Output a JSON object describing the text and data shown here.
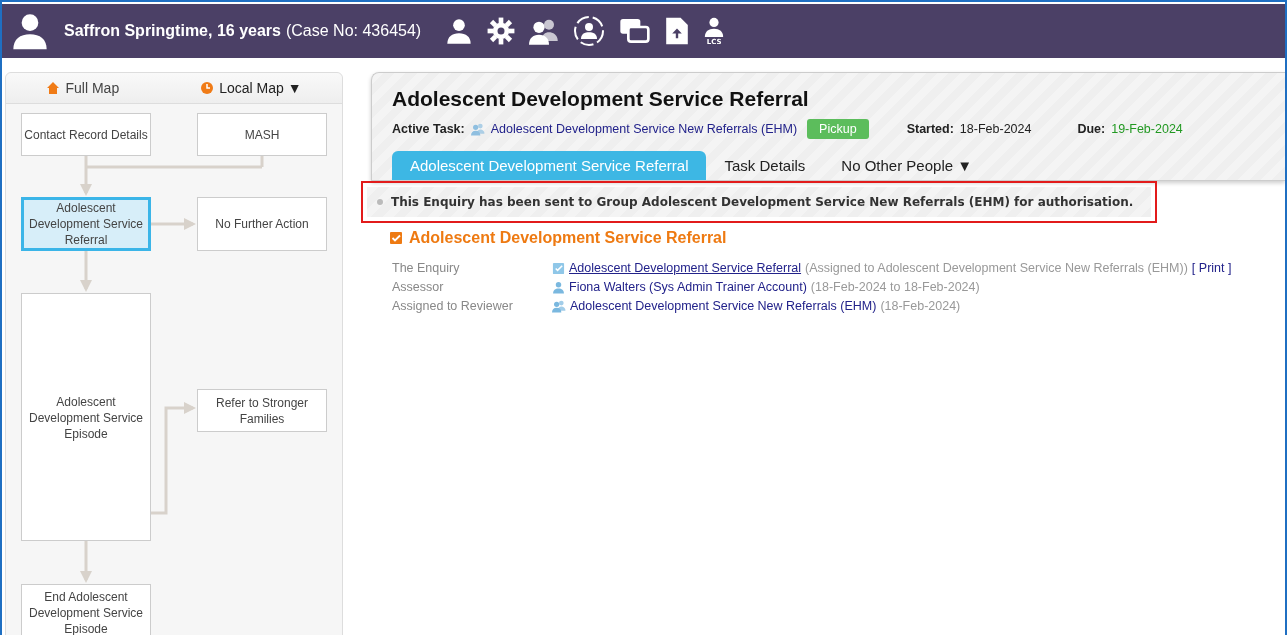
{
  "header": {
    "client_name": "Saffron Springtime, 16 years",
    "case_info": "(Case No: 436454)",
    "toolbar_badge": "LCS"
  },
  "map": {
    "tabs": [
      {
        "label": "Full Map",
        "selected": false
      },
      {
        "label": "Local Map ▼",
        "selected": true
      }
    ],
    "nodes": [
      {
        "label": "Contact Record Details",
        "selected": false
      },
      {
        "label": "MASH",
        "selected": false
      },
      {
        "label": "Adolescent Development Service Referral",
        "selected": true
      },
      {
        "label": "No Further Action",
        "selected": false
      },
      {
        "label": "Adolescent Development Service Episode",
        "selected": false
      },
      {
        "label": "Refer to Stronger Families",
        "selected": false
      },
      {
        "label": "End Adolescent Development Service Episode",
        "selected": false
      }
    ]
  },
  "task": {
    "title": "Adolescent Development Service Referral",
    "active_task_label": "Active Task:",
    "active_task": "Adolescent Development Service New Referrals (EHM)",
    "pickup_button": "Pickup",
    "started_label": "Started:",
    "started": "18-Feb-2024",
    "due_label": "Due:",
    "due": "19-Feb-2024",
    "tabs": [
      {
        "label": "Adolescent Development Service Referral",
        "selected": true
      },
      {
        "label": "Task Details",
        "selected": false
      },
      {
        "label": "No Other People ▼",
        "selected": false
      }
    ]
  },
  "notice": "This Enquiry has been sent to Group Adolescent Development Service New Referrals (EHM) for authorisation.",
  "section": {
    "title": "Adolescent Development Service Referral",
    "rows": [
      {
        "label": "The Enquiry",
        "kind": "form",
        "link": "Adolescent Development Service Referral",
        "note": "(Assigned to Adolescent Development Service New Referrals (EHM))",
        "action": "[ Print ]"
      },
      {
        "label": "Assessor",
        "kind": "person",
        "link": "Fiona Walters (Sys Admin Trainer Account)",
        "note": "(18-Feb-2024 to 18-Feb-2024)"
      },
      {
        "label": "Assigned to Reviewer",
        "kind": "group",
        "link": "Adolescent Development Service New Referrals (EHM)",
        "note": "(18-Feb-2024)"
      }
    ]
  }
}
